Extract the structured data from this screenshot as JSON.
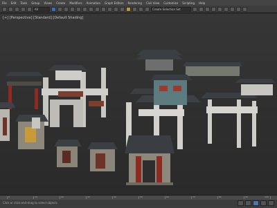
{
  "menubar": {
    "items": [
      "File",
      "Edit",
      "Tools",
      "Group",
      "Views",
      "Create",
      "Modifiers",
      "Animation",
      "Graph Editors",
      "Rendering",
      "Civil View",
      "Customize",
      "Scripting",
      "Help"
    ]
  },
  "toolbar": {
    "selection_filter": "All",
    "named_selection": "Create Selection Set"
  },
  "viewport": {
    "label": "[+] [Perspective] [Standard] [Default Shading]"
  },
  "timeline": {
    "frames": [
      "0",
      "10",
      "20",
      "30",
      "40",
      "50",
      "60",
      "70",
      "80",
      "90",
      "100"
    ]
  },
  "status": {
    "text": "Click or click-and-drag to select objects"
  },
  "colors": {
    "accent": "#4b78b0",
    "viewport_bg": "#333333"
  }
}
